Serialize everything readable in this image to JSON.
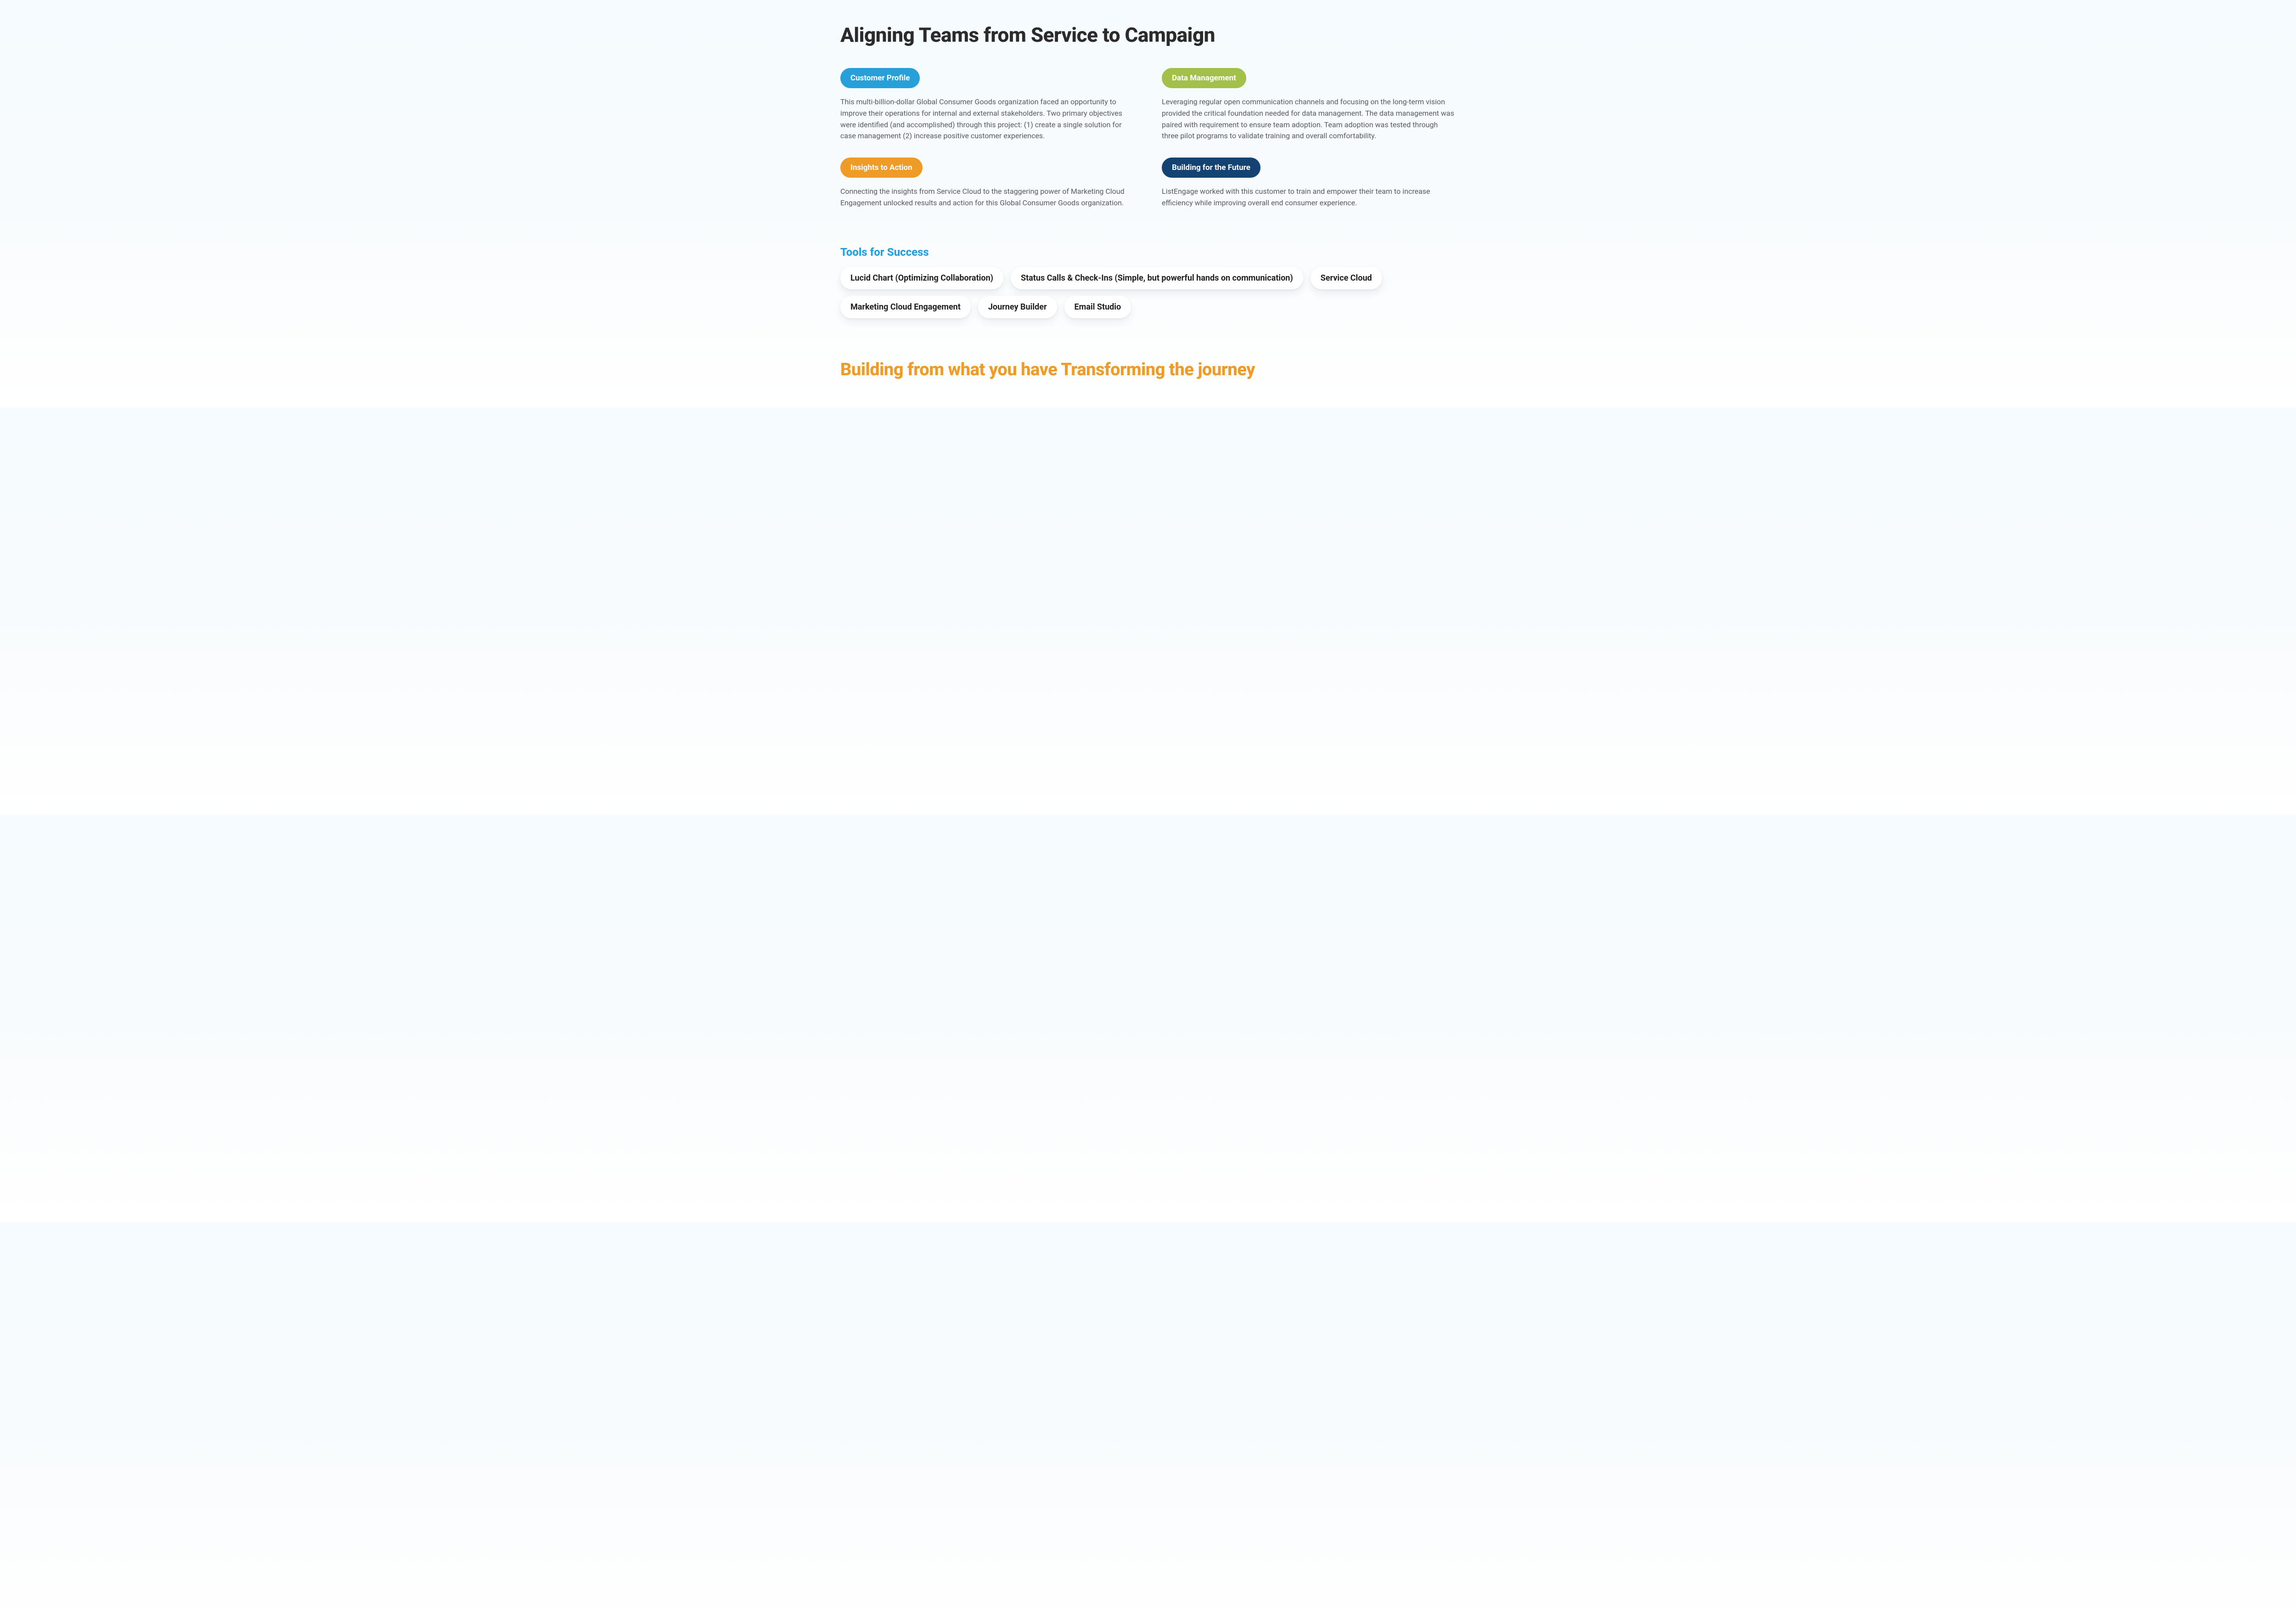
{
  "title": "Aligning Teams from Service to Campaign",
  "cards": [
    {
      "pill_class": "pill-blue",
      "label": "Customer Profile",
      "text": "This multi-billion-dollar Global Consumer Goods organization faced an opportunity to improve their operations for internal and external stakeholders. Two primary objectives were identified (and accomplished) through this project: (1) create a single solution for case management (2) increase positive customer experiences."
    },
    {
      "pill_class": "pill-green",
      "label": "Data Management",
      "text": "Leveraging regular open communication channels and focusing on the long-term vision provided the critical foundation needed for data management. The data management was paired with requirement to ensure team adoption. Team adoption was tested through three pilot programs to validate training and overall comfortability."
    },
    {
      "pill_class": "pill-orange",
      "label": "Insights to Action",
      "text": "Connecting the insights from Service Cloud to the staggering power of Marketing Cloud Engagement unlocked results and action for this Global Consumer Goods organization."
    },
    {
      "pill_class": "pill-navy",
      "label": "Building for the Future",
      "text": "ListEngage worked with this customer to train and empower their team to increase efficiency while improving overall end consumer experience."
    }
  ],
  "tools": {
    "heading": "Tools for Success",
    "items": [
      "Lucid Chart (Optimizing Collaboration)",
      "Status Calls & Check-Ins (Simple, but powerful hands on communication)",
      "Service Cloud",
      "Marketing Cloud Engagement",
      "Journey Builder",
      "Email Studio"
    ]
  },
  "footer_heading": "Building from what you have Transforming the journey"
}
